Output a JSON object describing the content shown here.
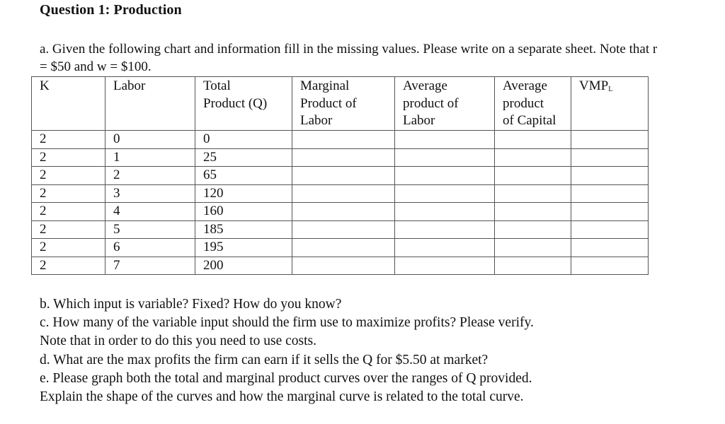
{
  "title": "Question 1:  Production",
  "intro": "a. Given the following chart and information fill in the missing values.  Please write on a separate sheet.  Note that r = $50 and w = $100.",
  "table": {
    "headers": [
      {
        "lines": [
          "K"
        ]
      },
      {
        "lines": [
          "Labor"
        ]
      },
      {
        "lines": [
          "Total",
          "Product (Q)"
        ]
      },
      {
        "lines": [
          "Marginal",
          "Product of",
          "Labor"
        ]
      },
      {
        "lines": [
          "Average",
          "product of",
          "Labor"
        ]
      },
      {
        "lines": [
          "Average",
          "product",
          "of Capital"
        ]
      },
      {
        "lines": [
          "VMP"
        ],
        "subscript": "L"
      }
    ],
    "rows": [
      {
        "k": "2",
        "labor": "0",
        "tp": "0",
        "mpl": "",
        "apl": "",
        "apk": "",
        "vmpl": ""
      },
      {
        "k": "2",
        "labor": "1",
        "tp": "25",
        "mpl": "",
        "apl": "",
        "apk": "",
        "vmpl": ""
      },
      {
        "k": "2",
        "labor": "2",
        "tp": "65",
        "mpl": "",
        "apl": "",
        "apk": "",
        "vmpl": ""
      },
      {
        "k": "2",
        "labor": "3",
        "tp": "120",
        "mpl": "",
        "apl": "",
        "apk": "",
        "vmpl": ""
      },
      {
        "k": "2",
        "labor": "4",
        "tp": "160",
        "mpl": "",
        "apl": "",
        "apk": "",
        "vmpl": ""
      },
      {
        "k": "2",
        "labor": "5",
        "tp": "185",
        "mpl": "",
        "apl": "",
        "apk": "",
        "vmpl": ""
      },
      {
        "k": "2",
        "labor": "6",
        "tp": "195",
        "mpl": "",
        "apl": "",
        "apk": "",
        "vmpl": ""
      },
      {
        "k": "2",
        "labor": "7",
        "tp": "200",
        "mpl": "",
        "apl": "",
        "apk": "",
        "vmpl": ""
      }
    ]
  },
  "questions": [
    "b. Which input is variable?  Fixed?   How do you know?",
    "c. How many of the variable input should the firm use to maximize profits?  Please verify.",
    "Note that in order to do this you need to use costs.",
    "d. What are the max profits the firm can earn if it sells the Q for $5.50 at market?",
    "e. Please graph both the total and marginal product curves over the ranges of Q provided.",
    "Explain the shape of the curves and how the marginal curve is related to the total curve."
  ]
}
